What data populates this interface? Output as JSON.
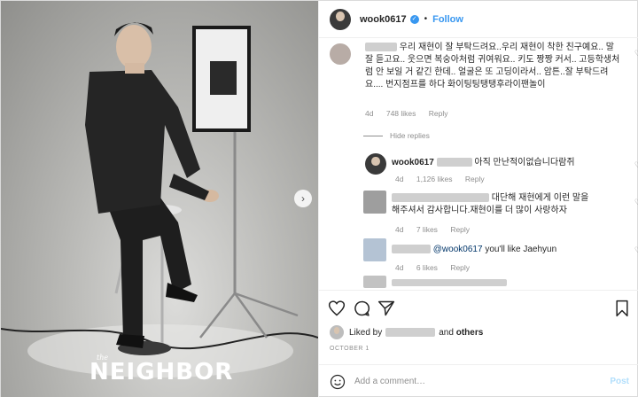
{
  "header": {
    "username": "wook0617",
    "separator": "•",
    "follow_label": "Follow"
  },
  "photo": {
    "watermark_small": "the",
    "watermark": "NEIGHBOR",
    "next_icon": "chevron-right-icon"
  },
  "comments": [
    {
      "text": "우리 재현이 잘 부탁드려요..우리 재현이 착한 친구예요.. 말 잘 듣고요.. 웃으면 복숭아처럼 귀여워요.. 키도 짱짱 커서.. 고등학생처럼 안 보일 거 같긴 한데.. 얼굴은 또 고딩이라서.. 암튼..잘 부탁드려요.... 번지점프를 하다 화이팅팅탱탱후라이팬놀이",
      "age": "4d",
      "likes": "748 likes",
      "reply": "Reply"
    }
  ],
  "hide_replies": "Hide replies",
  "replies": [
    {
      "username": "wook0617",
      "text": "아직 만난적이없습니다람쥐",
      "age": "4d",
      "likes": "1,126 likes",
      "reply": "Reply"
    },
    {
      "text_line1": "대단해 재현에게 이런 말을",
      "text_line2": "해주셔서 감사합니다.재현이를 더 많이 사랑하자",
      "age": "4d",
      "likes": "7 likes",
      "reply": "Reply"
    },
    {
      "mention": "@wook0617",
      "text": "you'll like Jaehyun",
      "age": "4d",
      "likes": "6 likes",
      "reply": "Reply"
    }
  ],
  "actions": {
    "like_icon": "heart-icon",
    "comment_icon": "comment-icon",
    "share_icon": "share-icon",
    "save_icon": "bookmark-icon"
  },
  "liked_by": {
    "prefix": "Liked by",
    "middle": "and",
    "others": "others"
  },
  "date": "OCTOBER 1",
  "add_comment": {
    "emoji_icon": "smiley-icon",
    "placeholder": "Add a comment…",
    "post_label": "Post"
  },
  "colors": {
    "link_blue": "#3897f0",
    "post_disabled": "#b2dffc",
    "meta_gray": "#8e8e8e"
  }
}
